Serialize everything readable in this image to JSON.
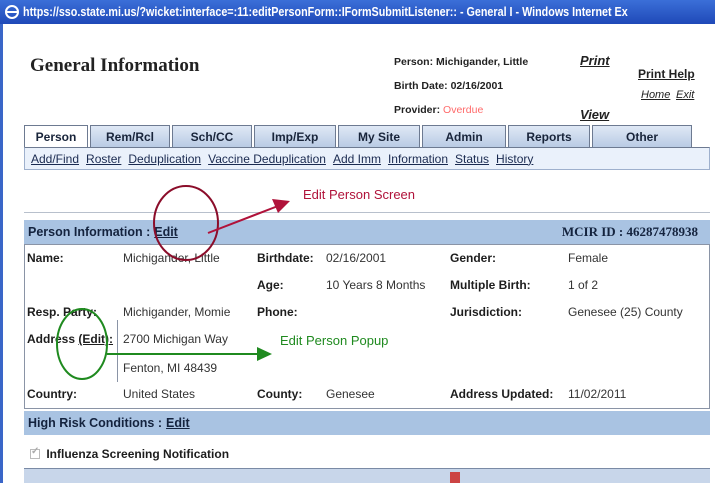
{
  "window": {
    "title": "https://sso.state.mi.us/?wicket:interface=:11:editPersonForm::IFormSubmitListener:: - General I - Windows Internet Ex"
  },
  "header": {
    "app_title": "General Information",
    "person_line": "Person: Michigander, Little",
    "birth_line": "Birth Date: 02/16/2001",
    "provider_label": "Provider:",
    "provider_status": "Overdue",
    "print": "Print",
    "view": "View",
    "print_help": "Print Help",
    "home": "Home",
    "exit": "Exit"
  },
  "tabs": [
    "Person",
    "Rem/Rcl",
    "Sch/CC",
    "Imp/Exp",
    "My Site",
    "Admin",
    "Reports",
    "Other"
  ],
  "active_tab": "Person",
  "subnav": [
    "Add/Find",
    "Roster",
    "Deduplication",
    "Vaccine Deduplication",
    "Add Imm",
    "Information",
    "Status",
    "History"
  ],
  "annotations": {
    "edit_person_screen": "Edit Person Screen",
    "edit_person_popup": "Edit Person Popup"
  },
  "person_info": {
    "header_label": "Person Information :",
    "header_edit": "Edit",
    "mcir_id": "MCIR ID : 46287478938",
    "name_label": "Name:",
    "name_value": "Michigander, Little",
    "birthdate_label": "Birthdate:",
    "birthdate_value": "02/16/2001",
    "gender_label": "Gender:",
    "gender_value": "Female",
    "age_label": "Age:",
    "age_value": "10 Years 8 Months",
    "multiple_birth_label": "Multiple Birth:",
    "multiple_birth_value": "1 of 2",
    "resp_party_label": "Resp. Party:",
    "resp_party_value": "Michigander, Momie",
    "phone_label": "Phone:",
    "jurisdiction_label": "Jurisdiction:",
    "jurisdiction_value": "Genesee (25) County",
    "address_label": "Address",
    "address_edit": "(Edit):",
    "address_line1": "2700 Michigan Way",
    "address_line2": "Fenton, MI 48439",
    "country_label": "Country:",
    "country_value": "United States",
    "county_label": "County:",
    "county_value": "Genesee",
    "address_updated_label": "Address Updated:",
    "address_updated_value": "11/02/2011"
  },
  "high_risk": {
    "header_label": "High Risk Conditions :",
    "header_edit": "Edit",
    "item": "Influenza Screening Notification"
  },
  "colors": {
    "accent": "#a9c3e2",
    "annotation_red": "#b0123a",
    "annotation_green": "#1f8a1f",
    "overdue": "#ff6a6a"
  }
}
